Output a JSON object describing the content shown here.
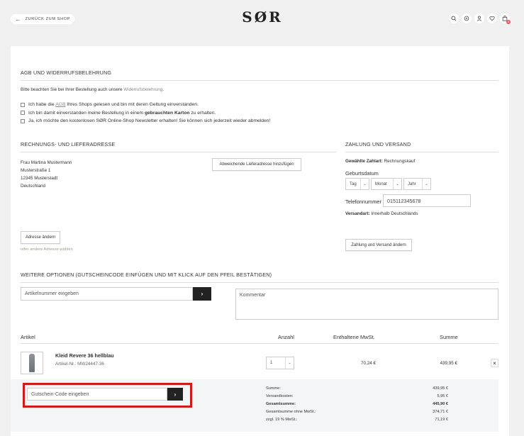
{
  "header": {
    "back_label": "ZURÜCK ZUM SHOP",
    "logo": "SØR",
    "cart_count": "0"
  },
  "agb": {
    "title": "AGB UND WIDERRUFSBELEHRUNG",
    "note_prefix": "Bitte beachten Sie bei Ihrer Bestellung auch unsere",
    "note_link": "Widerrufsbelehrung",
    "note_suffix": ".",
    "cb1_prefix": "Ich habe die",
    "cb1_link": "AGB",
    "cb1_suffix": "Ihres Shops gelesen und bin mit deren Geltung einverstanden.",
    "cb2_prefix": "Ich bin damit einverstanden meine Bestellung in einem",
    "cb2_bold": "gebrauchten Karton",
    "cb2_suffix": "zu erhalten.",
    "cb3": "Ja, ich möchte den kostenlosen SØR Online-Shop Newsletter erhalten! Sie können sich jederzeit wieder abmelden!"
  },
  "address": {
    "title": "RECHNUNGS- UND LIEFERADRESSE",
    "lines": [
      "Frau Martina Mustermann",
      "Musterstraße 1",
      "12345 Musterstadt",
      "Deutschland"
    ],
    "alt_delivery_button": "Abweichende Lieferadresse hinzufügen",
    "change_button": "Adresse ändern",
    "other_link": "oder andere Adresse wählen"
  },
  "payment": {
    "title": "ZAHLUNG UND VERSAND",
    "method_label": "Gewählte Zahlart:",
    "method_value": "Rechnungskauf",
    "birth_label": "Geburtsdatum",
    "day": "Tag",
    "month": "Monat",
    "year": "Jahr",
    "phone_label": "Telefonnummer",
    "phone_value": "015112345678",
    "shipping_label": "Versandart:",
    "shipping_value": "Innerhalb Deutschlands",
    "change_button": "Zahlung und Versand ändern"
  },
  "options": {
    "title": "WEITERE OPTIONEN (GUTSCHEINCODE EINFÜGEN UND MIT KLICK AUF DEN PFEIL BESTÄTIGEN)",
    "article_placeholder": "Artikelnummer eingeben",
    "comment_placeholder": "Kommentar",
    "go": "›"
  },
  "table": {
    "headers": {
      "article": "Artikel",
      "qty": "Anzahl",
      "vat": "Enthaltene MwSt.",
      "sum": "Summe"
    },
    "item": {
      "name": "Kleid Revere 36 hellblau",
      "sku": "Artikel-Nr.: MW24447-36",
      "qty": "1",
      "vat": "70,24 €",
      "sum": "439,95 €",
      "remove": "×"
    }
  },
  "voucher": {
    "placeholder": "Gutschein-Code eingeben",
    "go": "›"
  },
  "totals": [
    {
      "label": "Summe:",
      "value": "439,95 €"
    },
    {
      "label": "Versandkosten:",
      "value": "5,95 €"
    },
    {
      "label": "Gesamtsumme:",
      "value": "445,90 €"
    },
    {
      "label": "Gesamtsumme ohne MwSt.:",
      "value": "374,71 €"
    },
    {
      "label": "zzgl. 19 % MwSt.:",
      "value": "71,19 €"
    }
  ],
  "colors": {
    "accent_highlight": "#d01b1b",
    "dark_button": "#222222",
    "badge": "#e35b6b"
  }
}
